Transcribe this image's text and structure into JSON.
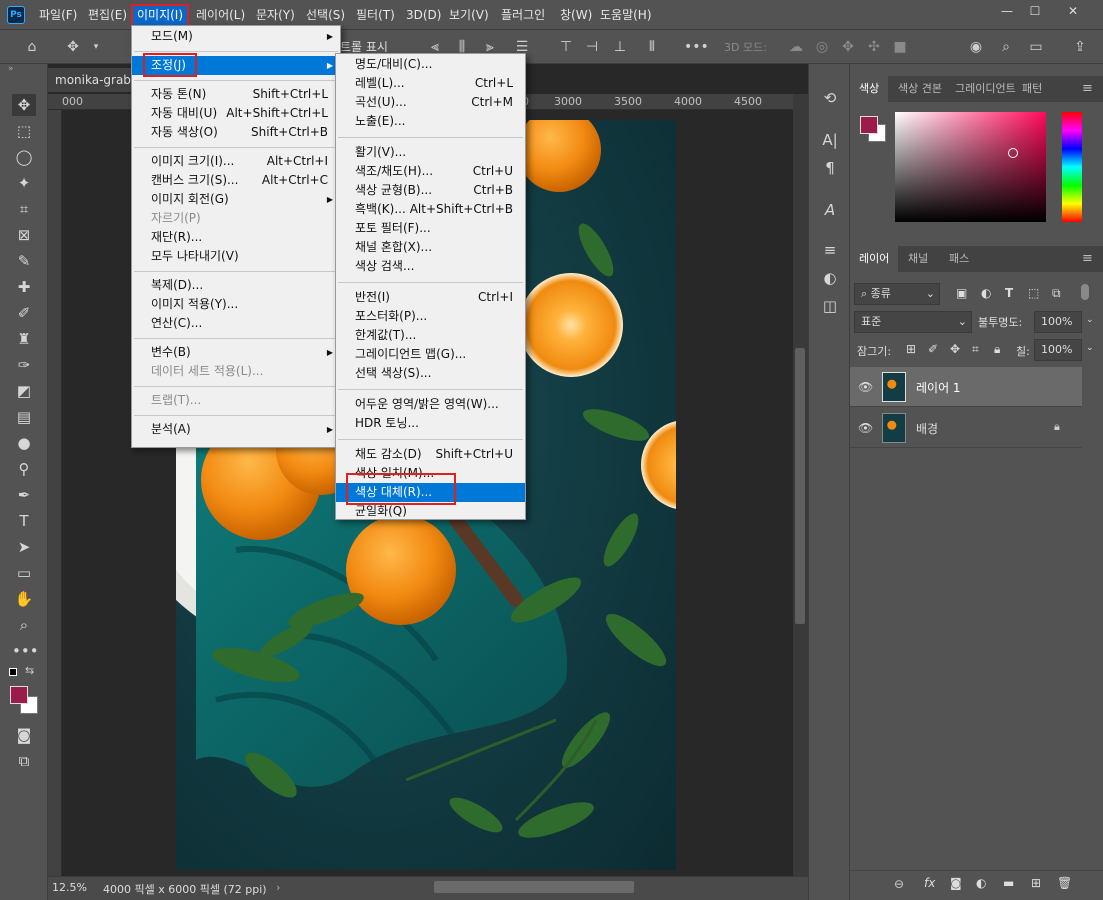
{
  "app": {
    "logo": "Ps"
  },
  "menubar": {
    "items": [
      "파일(F)",
      "편집(E)",
      "이미지(I)",
      "레이어(L)",
      "문자(Y)",
      "선택(S)",
      "필터(T)",
      "3D(D)",
      "보기(V)",
      "플러그인",
      "창(W)",
      "도움말(H)"
    ],
    "active": "이미지(I)"
  },
  "window_controls": {
    "minimize": "—",
    "maximize": "☐",
    "close": "✕"
  },
  "options": {
    "partial_label": "트롤 표시",
    "mode3d": "3D 모드:"
  },
  "document": {
    "tab": "monika-grabko",
    "zoom": "12.5%",
    "info": "4000 픽셀 x 6000 픽셀 (72 ppi)"
  },
  "ruler": {
    "labels": [
      "000",
      "500",
      "3000",
      "3500",
      "4000",
      "4500"
    ]
  },
  "image_menu": [
    {
      "label": "모드(M)",
      "submenu": true
    },
    {
      "sep": true
    },
    {
      "label": "조정(J)",
      "submenu": true,
      "highlight": true
    },
    {
      "sep": true
    },
    {
      "label": "자동 톤(N)",
      "shortcut": "Shift+Ctrl+L"
    },
    {
      "label": "자동 대비(U)",
      "shortcut": "Alt+Shift+Ctrl+L"
    },
    {
      "label": "자동 색상(O)",
      "shortcut": "Shift+Ctrl+B"
    },
    {
      "sep": true
    },
    {
      "label": "이미지 크기(I)...",
      "shortcut": "Alt+Ctrl+I"
    },
    {
      "label": "캔버스 크기(S)...",
      "shortcut": "Alt+Ctrl+C"
    },
    {
      "label": "이미지 회전(G)",
      "submenu": true
    },
    {
      "label": "자르기(P)",
      "disabled": true
    },
    {
      "label": "재단(R)..."
    },
    {
      "label": "모두 나타내기(V)"
    },
    {
      "sep": true
    },
    {
      "label": "복제(D)..."
    },
    {
      "label": "이미지 적용(Y)..."
    },
    {
      "label": "연산(C)..."
    },
    {
      "sep": true
    },
    {
      "label": "변수(B)",
      "submenu": true
    },
    {
      "label": "데이터 세트 적용(L)...",
      "disabled": true
    },
    {
      "sep": true
    },
    {
      "label": "트랩(T)...",
      "disabled": true
    },
    {
      "sep": true
    },
    {
      "label": "분석(A)",
      "submenu": true
    }
  ],
  "adjust_menu": [
    {
      "label": "명도/대비(C)..."
    },
    {
      "label": "레벨(L)...",
      "shortcut": "Ctrl+L"
    },
    {
      "label": "곡선(U)...",
      "shortcut": "Ctrl+M"
    },
    {
      "label": "노출(E)..."
    },
    {
      "sep": true
    },
    {
      "label": "활기(V)..."
    },
    {
      "label": "색조/채도(H)...",
      "shortcut": "Ctrl+U"
    },
    {
      "label": "색상 균형(B)...",
      "shortcut": "Ctrl+B"
    },
    {
      "label": "흑백(K)...",
      "shortcut": "Alt+Shift+Ctrl+B"
    },
    {
      "label": "포토 필터(F)..."
    },
    {
      "label": "채널 혼합(X)..."
    },
    {
      "label": "색상 검색..."
    },
    {
      "sep": true
    },
    {
      "label": "반전(I)",
      "shortcut": "Ctrl+I"
    },
    {
      "label": "포스터화(P)..."
    },
    {
      "label": "한계값(T)..."
    },
    {
      "label": "그레이디언트 맵(G)..."
    },
    {
      "label": "선택 색상(S)..."
    },
    {
      "sep": true
    },
    {
      "label": "어두운 영역/밝은 영역(W)..."
    },
    {
      "label": "HDR 토닝..."
    },
    {
      "sep": true
    },
    {
      "label": "채도 감소(D)",
      "shortcut": "Shift+Ctrl+U"
    },
    {
      "label": "색상 일치(M)..."
    },
    {
      "label": "색상 대체(R)...",
      "highlight": true
    },
    {
      "label": "균일화(Q)"
    }
  ],
  "color_panel": {
    "tabs": [
      "색상",
      "색상 견본",
      "그레이디언트",
      "패턴"
    ],
    "foreground": "#9b1b4b",
    "background": "#ffffff"
  },
  "layers_panel": {
    "tabs": [
      "레이어",
      "채널",
      "패스"
    ],
    "filter": "종류",
    "blend_mode": "표준",
    "opacity_label": "불투명도:",
    "opacity": "100%",
    "lock_label": "잠그기:",
    "fill_label": "칠:",
    "fill": "100%",
    "layers": [
      {
        "name": "레이어 1",
        "selected": true
      },
      {
        "name": "배경",
        "locked": true
      }
    ],
    "footer_fx": "fx"
  },
  "colors": {
    "accent": "#0078d7",
    "highlight_box": "#e02020",
    "panel": "#535353"
  }
}
